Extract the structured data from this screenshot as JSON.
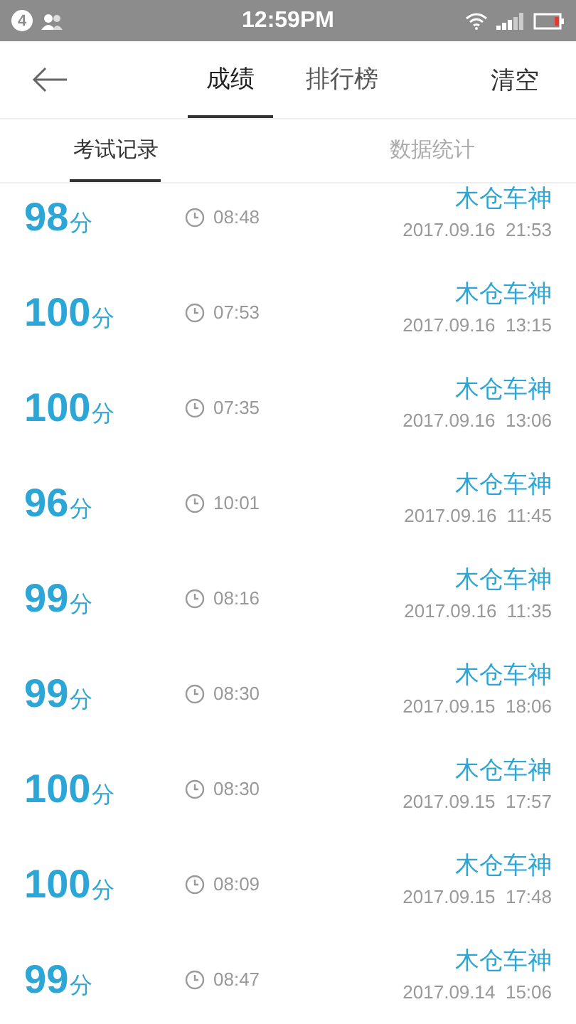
{
  "status_bar": {
    "notification_count": "4",
    "time": "12:59PM"
  },
  "header": {
    "tabs": [
      {
        "label": "成绩",
        "selected": true
      },
      {
        "label": "排行榜",
        "selected": false
      }
    ],
    "action": "清空"
  },
  "subtabs": [
    {
      "label": "考试记录",
      "selected": true
    },
    {
      "label": "数据统计",
      "selected": false
    }
  ],
  "records": [
    {
      "score": "98",
      "unit": "分",
      "duration": "08:48",
      "name": "木仓车神",
      "date": "2017.09.16  21:53"
    },
    {
      "score": "100",
      "unit": "分",
      "duration": "07:53",
      "name": "木仓车神",
      "date": "2017.09.16  13:15"
    },
    {
      "score": "100",
      "unit": "分",
      "duration": "07:35",
      "name": "木仓车神",
      "date": "2017.09.16  13:06"
    },
    {
      "score": "96",
      "unit": "分",
      "duration": "10:01",
      "name": "木仓车神",
      "date": "2017.09.16  11:45"
    },
    {
      "score": "99",
      "unit": "分",
      "duration": "08:16",
      "name": "木仓车神",
      "date": "2017.09.16  11:35"
    },
    {
      "score": "99",
      "unit": "分",
      "duration": "08:30",
      "name": "木仓车神",
      "date": "2017.09.15  18:06"
    },
    {
      "score": "100",
      "unit": "分",
      "duration": "08:30",
      "name": "木仓车神",
      "date": "2017.09.15  17:57"
    },
    {
      "score": "100",
      "unit": "分",
      "duration": "08:09",
      "name": "木仓车神",
      "date": "2017.09.15  17:48"
    },
    {
      "score": "99",
      "unit": "分",
      "duration": "08:47",
      "name": "木仓车神",
      "date": "2017.09.14  15:06"
    }
  ]
}
